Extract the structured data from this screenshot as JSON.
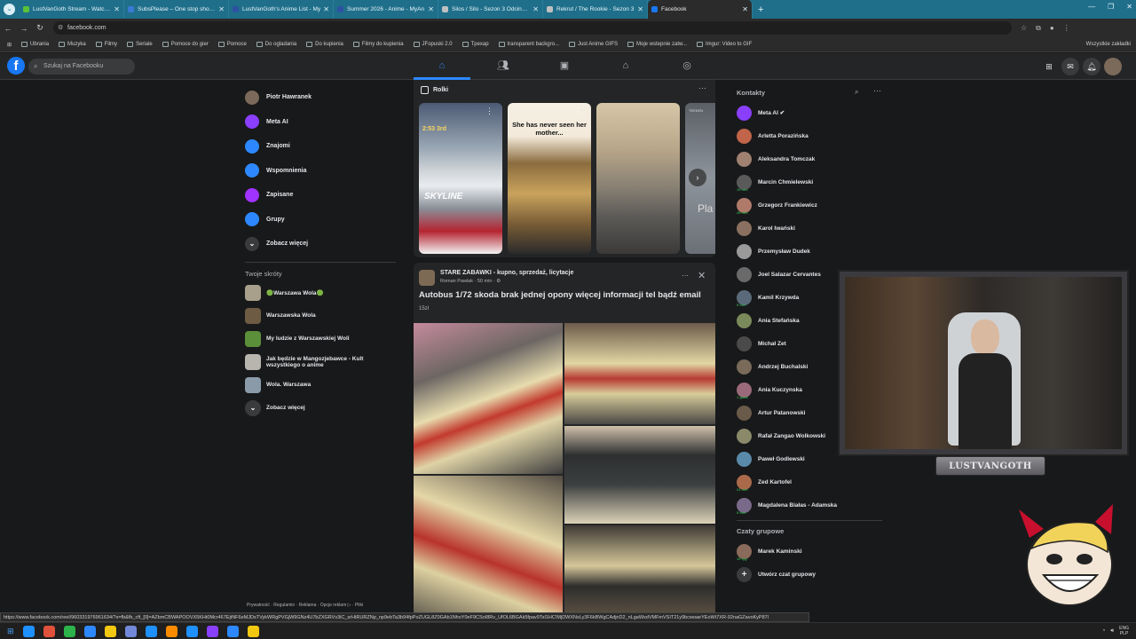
{
  "browser": {
    "tabs": [
      {
        "label": "LustVanGoth Stream - Watch Li",
        "icon_color": "#5bc236"
      },
      {
        "label": "SubsPlease – One stop shop fo",
        "icon_color": "#3a7ad5"
      },
      {
        "label": "LustVanGoth's Anime List - My",
        "icon_color": "#2e51a2"
      },
      {
        "label": "Summer 2026 - Anime - MyAn",
        "icon_color": "#2e51a2"
      },
      {
        "label": "Silos / Silo - Sezon 3 Odcinek 2",
        "icon_color": "#c0c0c0"
      },
      {
        "label": "Rekrut / The Rookie - Sezon 3",
        "icon_color": "#c0c0c0"
      },
      {
        "label": "Facebook",
        "icon_color": "#1877f2",
        "active": true
      }
    ],
    "url": "facebook.com",
    "bookmarks": [
      "Ubrania",
      "Muzyka",
      "Filmy",
      "Seriale",
      "Pomoce do gier",
      "Pomoce",
      "Do ogladania",
      "Do kupienia",
      "Filmy do kupienia",
      "JFopuski 2.0",
      "Tpexap",
      "transparent backgro...",
      "Just Anime GIFS",
      "Moje wstepnie zatw...",
      "Imgur: Video to GIF"
    ],
    "bookmarks_right": "Wszystkie zakładki",
    "status_url": "https://www.facebook.com/reel/960331976961634/?s=fb&fb_cft_[0]=AZbmCBWAPOOVX5KHt0Mcr467EjtNF6eMJDsTVykWRgPVGjW9GNz4U7bZXGRVv3iC_srHtRURZNp_np9ebTa3b94fpPoZUGL8Z0GAb1NhoY0eF9CSoI8Rv_UfOL6BGAk5fpav9TsI1HC!MjDWXNxLy3F6kBWgCAdjnD2_nLgaWsdVMFmVSIT21y9bcwoaeYEoWt7XR-92naGZavoKyP87l"
  },
  "facebook": {
    "search_placeholder": "Szukaj na Facebooku",
    "left_nav": [
      {
        "label": "Piotr Hawranek",
        "icon": "avatar",
        "color": "#7b6a5a"
      },
      {
        "label": "Meta AI",
        "icon": "meta-ai-icon",
        "color": "#8a3ffc"
      },
      {
        "label": "Znajomi",
        "icon": "friends-icon",
        "color": "#2d88ff"
      },
      {
        "label": "Wspomnienia",
        "icon": "memories-icon",
        "color": "#2d88ff"
      },
      {
        "label": "Zapisane",
        "icon": "saved-icon",
        "color": "#a033ff"
      },
      {
        "label": "Grupy",
        "icon": "groups-icon",
        "color": "#2d88ff"
      },
      {
        "label": "Zobacz więcej",
        "icon": "chevron-down-icon",
        "color": "#3a3b3c"
      }
    ],
    "shortcuts_title": "Twoje skróty",
    "shortcuts": [
      {
        "label": "🟢Warszawa Wola🟢",
        "color": "#a8a08a"
      },
      {
        "label": "Warszawska Wola",
        "color": "#6d5b44"
      },
      {
        "label": "My ludzie z Warszawskiej Woli",
        "color": "#5b8f3a"
      },
      {
        "label": "Jak będzie w Mangozjebawce - Kult wszystkiego o anime",
        "color": "#b8b4ae"
      },
      {
        "label": "Wola. Warszawa",
        "color": "#8a9aa8"
      },
      {
        "label": "Zobacz więcej",
        "color": "#3a3b3c"
      }
    ],
    "footer": "Prywatność · Regulamin · Reklama · Opcje reklam ▷ · Pliki",
    "reels": {
      "title": "Rolki",
      "reel1_caption_top": "2:53 3rd",
      "reel1_caption": "SKYLINE",
      "reel2_caption": "She has never seen her mother...",
      "reel4_caption": "Pla",
      "reel4_badge": "TEEKEN"
    },
    "post": {
      "group": "STARE ZABAWKI - kupno, sprzedaż, licytacje",
      "meta": "Roman Pawlak · 50 min · ⚙",
      "title": "Autobus 1/72 skoda brak jednej opony więcej informacji tel bądź email",
      "price": "15zł"
    },
    "contacts_title": "Kontakty",
    "contacts": [
      {
        "name": "Meta AI ✔",
        "color": "#8a3ffc",
        "badge": ""
      },
      {
        "name": "Arletta Porazińska",
        "color": "#c0644a",
        "badge": ""
      },
      {
        "name": "Aleksandra Tomczak",
        "color": "#a08070",
        "badge": ""
      },
      {
        "name": "Marcin Chmielewski",
        "color": "#5a5a5a",
        "badge": "19 min"
      },
      {
        "name": "Grzegorz Frankiewicz",
        "color": "#b07a6a",
        "badge": "29 min"
      },
      {
        "name": "Karol Iwański",
        "color": "#8a7060",
        "badge": ""
      },
      {
        "name": "Przemysław Dudek",
        "color": "#9a9a9a",
        "badge": ""
      },
      {
        "name": "Joel Salazar Cervantes",
        "color": "#6a6a6a",
        "badge": ""
      },
      {
        "name": "Kamil Krzywda",
        "color": "#5a6a7a",
        "badge": "5 min"
      },
      {
        "name": "Ania Stefańska",
        "color": "#7a8a5a",
        "badge": ""
      },
      {
        "name": "Michał Zet",
        "color": "#4a4a4a",
        "badge": ""
      },
      {
        "name": "Andrzej Buchalski",
        "color": "#7a6a5a",
        "badge": ""
      },
      {
        "name": "Ania Kuczynska",
        "color": "#9a6a7a",
        "badge": "1 godz."
      },
      {
        "name": "Artur Patanowski",
        "color": "#6a5a4a",
        "badge": ""
      },
      {
        "name": "Rafał Zangao Wolkowski",
        "color": "#8a8a6a",
        "badge": ""
      },
      {
        "name": "Paweł Godlewski",
        "color": "#5a8aaa",
        "badge": ""
      },
      {
        "name": "Zed Kartofel",
        "color": "#aa6a4a",
        "badge": "21 min"
      },
      {
        "name": "Magdalena Białas - Adamska",
        "color": "#7a6a8a",
        "badge": "5 min"
      }
    ],
    "group_chats_title": "Czaty grupowe",
    "group_chats": [
      {
        "name": "Marek Kaminski",
        "color": "#8a6a5a",
        "badge": "19 tyg."
      },
      {
        "name": "Utwórz czat grupowy",
        "color": "#3a3b3c",
        "badge": ""
      }
    ]
  },
  "overlay": {
    "frame_label": "LUSTVANGOTH"
  },
  "taskbar": {
    "lang": "ENG\nPLP",
    "icons": [
      "#1e90ff",
      "#e0513b",
      "#2cb34a",
      "#2d88ff",
      "#f2c811",
      "#7289da",
      "#1e90ff",
      "#ff8c00",
      "#1e90ff",
      "#8a3ffc",
      "#2d88ff",
      "#f2c811"
    ]
  }
}
